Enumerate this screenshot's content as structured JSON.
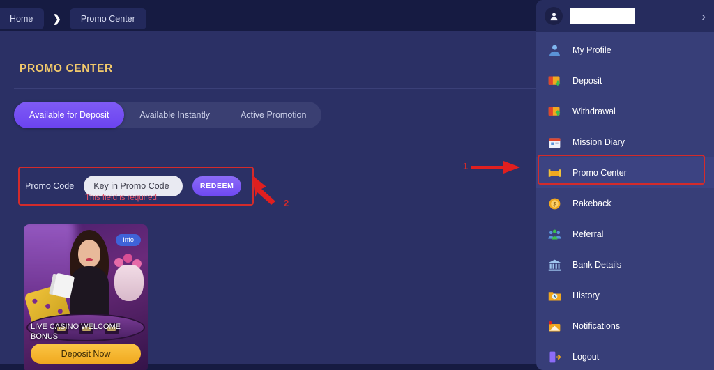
{
  "breadcrumb": {
    "items": [
      {
        "label": "Home",
        "name": "breadcrumb-home"
      },
      {
        "label": "Promo Center",
        "name": "breadcrumb-promo-center"
      }
    ],
    "separator": "❯"
  },
  "main": {
    "title": "PROMO CENTER",
    "tabs": [
      {
        "label": "Available for Deposit",
        "active": true
      },
      {
        "label": "Available Instantly",
        "active": false
      },
      {
        "label": "Active Promotion",
        "active": false
      }
    ],
    "promo_code": {
      "label": "Promo Code",
      "placeholder": "Key in Promo Code",
      "value": "",
      "button_label": "REDEEM",
      "error": "This field is required."
    },
    "promo_card": {
      "badge": "Info",
      "title": "LIVE CASINO WELCOME BONUS",
      "cta": "Deposit Now"
    }
  },
  "sidebar": {
    "username": "",
    "chevron": "›",
    "items": [
      {
        "label": "My Profile",
        "icon": "profile-icon"
      },
      {
        "label": "Deposit",
        "icon": "deposit-icon"
      },
      {
        "label": "Withdrawal",
        "icon": "withdrawal-icon"
      },
      {
        "label": "Mission Diary",
        "icon": "calendar-icon"
      },
      {
        "label": "Promo Center",
        "icon": "promo-icon"
      },
      {
        "label": "Rakeback",
        "icon": "coin-icon"
      },
      {
        "label": "Referral",
        "icon": "people-icon"
      },
      {
        "label": "Bank Details",
        "icon": "bank-icon"
      },
      {
        "label": "History",
        "icon": "folder-icon"
      },
      {
        "label": "Notifications",
        "icon": "envelope-icon"
      },
      {
        "label": "Logout",
        "icon": "logout-icon"
      }
    ]
  },
  "annotations": [
    {
      "label": "1",
      "target": "Promo Center sidebar item"
    },
    {
      "label": "2",
      "target": "Promo Code field"
    }
  ],
  "colors": {
    "page_background": "#161b42",
    "panel_background": "#2b3065",
    "sidebar_background": "#373e78",
    "accent_purple": "#6f49f2",
    "title_gold": "#f2c96b",
    "annotation_red": "#d32b2b",
    "error_red": "#e0536b",
    "cta_gold": "#f0a81f"
  }
}
